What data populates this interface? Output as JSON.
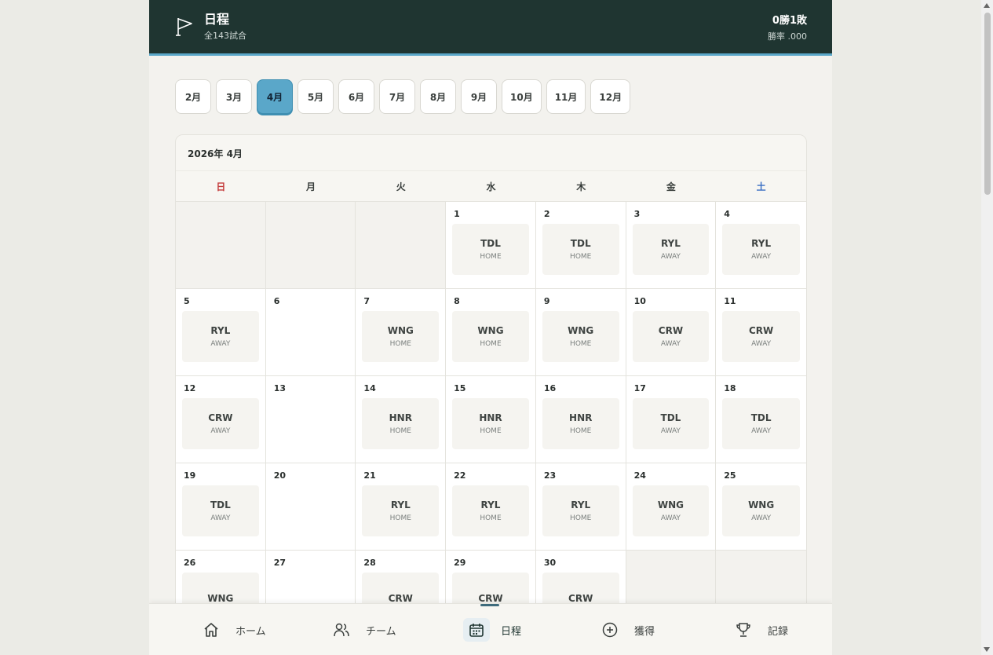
{
  "header": {
    "title": "日程",
    "subtitle": "全143試合",
    "record": "0勝1敗",
    "win_rate": "勝率 .000"
  },
  "months": [
    "2月",
    "3月",
    "4月",
    "5月",
    "6月",
    "7月",
    "8月",
    "9月",
    "10月",
    "11月",
    "12月"
  ],
  "active_month": "4月",
  "calendar": {
    "title": "2026年 4月",
    "weekdays": [
      "日",
      "月",
      "火",
      "水",
      "木",
      "金",
      "土"
    ],
    "cells": [
      {
        "day": "",
        "opp": "",
        "ha": ""
      },
      {
        "day": "",
        "opp": "",
        "ha": ""
      },
      {
        "day": "",
        "opp": "",
        "ha": ""
      },
      {
        "day": "1",
        "opp": "TDL",
        "ha": "HOME"
      },
      {
        "day": "2",
        "opp": "TDL",
        "ha": "HOME"
      },
      {
        "day": "3",
        "opp": "RYL",
        "ha": "AWAY"
      },
      {
        "day": "4",
        "opp": "RYL",
        "ha": "AWAY"
      },
      {
        "day": "5",
        "opp": "RYL",
        "ha": "AWAY"
      },
      {
        "day": "6",
        "opp": "",
        "ha": ""
      },
      {
        "day": "7",
        "opp": "WNG",
        "ha": "HOME"
      },
      {
        "day": "8",
        "opp": "WNG",
        "ha": "HOME"
      },
      {
        "day": "9",
        "opp": "WNG",
        "ha": "HOME"
      },
      {
        "day": "10",
        "opp": "CRW",
        "ha": "AWAY"
      },
      {
        "day": "11",
        "opp": "CRW",
        "ha": "AWAY"
      },
      {
        "day": "12",
        "opp": "CRW",
        "ha": "AWAY"
      },
      {
        "day": "13",
        "opp": "",
        "ha": ""
      },
      {
        "day": "14",
        "opp": "HNR",
        "ha": "HOME"
      },
      {
        "day": "15",
        "opp": "HNR",
        "ha": "HOME"
      },
      {
        "day": "16",
        "opp": "HNR",
        "ha": "HOME"
      },
      {
        "day": "17",
        "opp": "TDL",
        "ha": "AWAY"
      },
      {
        "day": "18",
        "opp": "TDL",
        "ha": "AWAY"
      },
      {
        "day": "19",
        "opp": "TDL",
        "ha": "AWAY"
      },
      {
        "day": "20",
        "opp": "",
        "ha": ""
      },
      {
        "day": "21",
        "opp": "RYL",
        "ha": "HOME"
      },
      {
        "day": "22",
        "opp": "RYL",
        "ha": "HOME"
      },
      {
        "day": "23",
        "opp": "RYL",
        "ha": "HOME"
      },
      {
        "day": "24",
        "opp": "WNG",
        "ha": "AWAY"
      },
      {
        "day": "25",
        "opp": "WNG",
        "ha": "AWAY"
      },
      {
        "day": "26",
        "opp": "WNG",
        "ha": ""
      },
      {
        "day": "27",
        "opp": "",
        "ha": ""
      },
      {
        "day": "28",
        "opp": "CRW",
        "ha": ""
      },
      {
        "day": "29",
        "opp": "CRW",
        "ha": ""
      },
      {
        "day": "30",
        "opp": "CRW",
        "ha": ""
      },
      {
        "day": "",
        "opp": "",
        "ha": ""
      },
      {
        "day": "",
        "opp": "",
        "ha": ""
      }
    ]
  },
  "nav": {
    "home": "ホーム",
    "team": "チーム",
    "schedule": "日程",
    "acquire": "獲得",
    "records": "記録"
  }
}
